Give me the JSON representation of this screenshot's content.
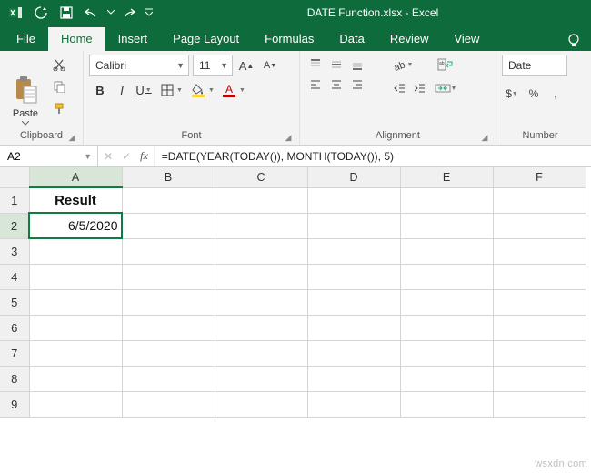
{
  "window": {
    "title": "DATE Function.xlsx - Excel",
    "app_name": "Excel"
  },
  "quick_access": {
    "autosave": "⟳",
    "save": "💾",
    "undo": "↶",
    "redo": "↷"
  },
  "tabs": {
    "file": "File",
    "home": "Home",
    "insert": "Insert",
    "page_layout": "Page Layout",
    "formulas": "Formulas",
    "data": "Data",
    "review": "Review",
    "view": "View"
  },
  "ribbon": {
    "clipboard": {
      "label": "Clipboard",
      "paste": "Paste"
    },
    "font": {
      "label": "Font",
      "family": "Calibri",
      "size": "11",
      "b": "B",
      "i": "I",
      "u": "U"
    },
    "alignment": {
      "label": "Alignment"
    },
    "number": {
      "label": "Number",
      "format": "Date"
    }
  },
  "formula_bar": {
    "name_box": "A2",
    "formula": "=DATE(YEAR(TODAY()), MONTH(TODAY()), 5)"
  },
  "grid": {
    "columns": [
      "A",
      "B",
      "C",
      "D",
      "E",
      "F"
    ],
    "row_count": 9,
    "active_col_index": 0,
    "active_row_index": 1,
    "cells": {
      "A1": "Result",
      "A2": "6/5/2020"
    }
  },
  "watermark": "wsxdn.com",
  "colors": {
    "brand": "#0e6b3b",
    "active": "#107c41",
    "font_fill": "#ffd52e",
    "font_color": "#c00000"
  },
  "chart_data": {
    "type": "table",
    "title": "Excel worksheet showing DATE function result",
    "columns": [
      "A"
    ],
    "rows": [
      [
        "Result"
      ],
      [
        "6/5/2020"
      ]
    ],
    "formula_for_A2": "=DATE(YEAR(TODAY()), MONTH(TODAY()), 5)"
  }
}
